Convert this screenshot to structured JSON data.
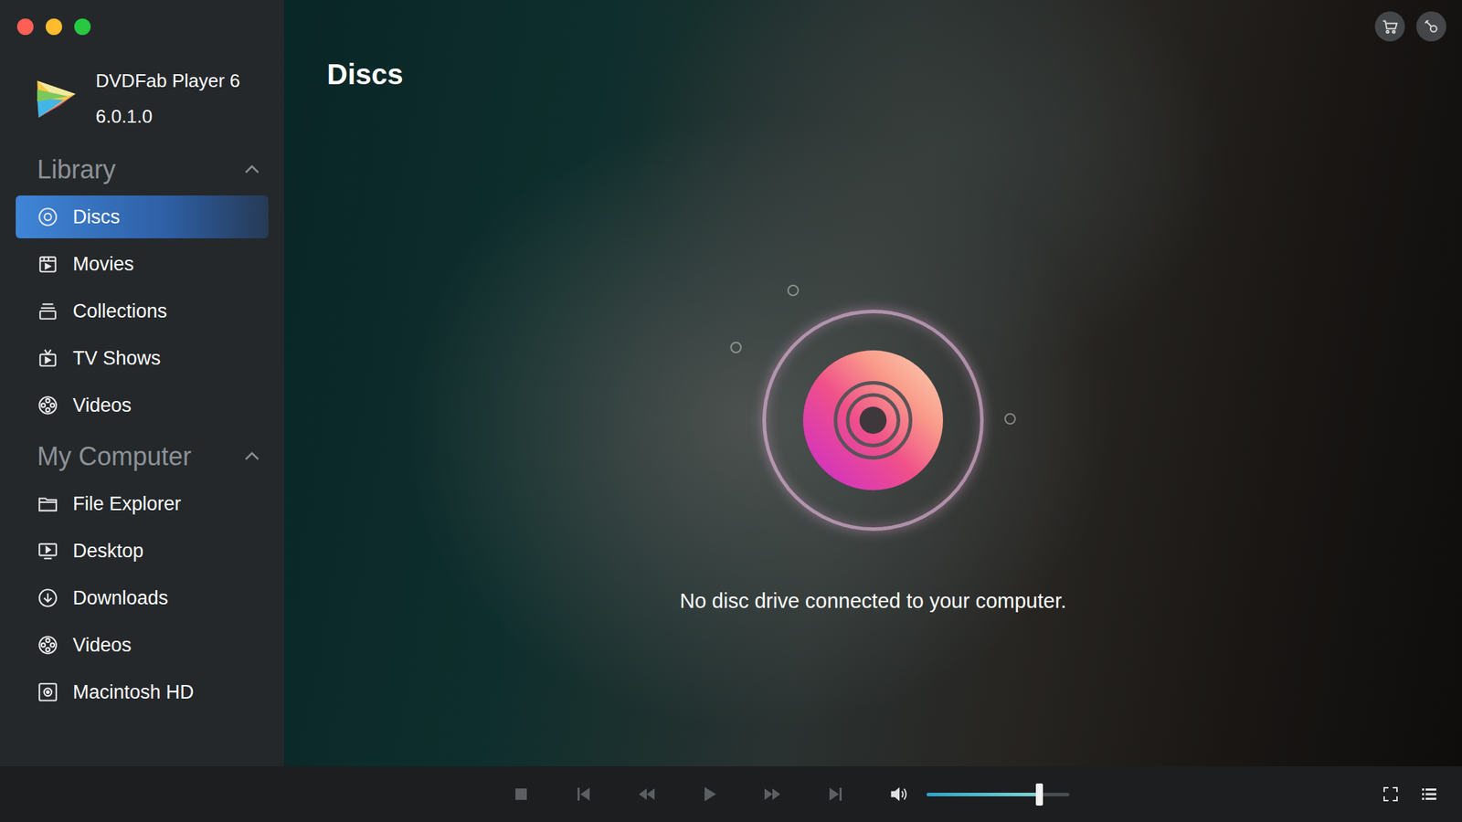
{
  "app": {
    "name": "DVDFab Player 6",
    "version": "6.0.1.0"
  },
  "sidebar": {
    "sections": [
      {
        "title": "Library",
        "expanded": true,
        "items": [
          {
            "label": "Discs",
            "selected": true
          },
          {
            "label": "Movies",
            "selected": false
          },
          {
            "label": "Collections",
            "selected": false
          },
          {
            "label": "TV Shows",
            "selected": false
          },
          {
            "label": "Videos",
            "selected": false
          }
        ]
      },
      {
        "title": "My Computer",
        "expanded": true,
        "items": [
          {
            "label": "File Explorer",
            "selected": false
          },
          {
            "label": "Desktop",
            "selected": false
          },
          {
            "label": "Downloads",
            "selected": false
          },
          {
            "label": "Videos",
            "selected": false
          },
          {
            "label": "Macintosh HD",
            "selected": false
          }
        ]
      }
    ]
  },
  "page": {
    "title": "Discs",
    "message": "No disc drive connected to your computer."
  },
  "player": {
    "transport_disabled": true,
    "volume": {
      "level": 0.79,
      "muted": false
    }
  }
}
